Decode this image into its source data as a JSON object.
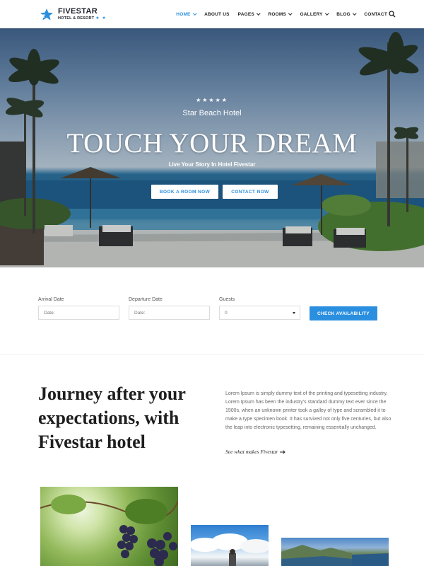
{
  "brand": {
    "name": "FIVESTAR",
    "sub": "HOTEL & RESORT",
    "stars": "★ ★",
    "accent_color": "#2b8fe0"
  },
  "nav": {
    "items": [
      {
        "label": "HOME",
        "dropdown": true,
        "active": true
      },
      {
        "label": "ABOUT US",
        "dropdown": false,
        "active": false
      },
      {
        "label": "PAGES",
        "dropdown": true,
        "active": false
      },
      {
        "label": "ROOMS",
        "dropdown": true,
        "active": false
      },
      {
        "label": "GALLERY",
        "dropdown": true,
        "active": false
      },
      {
        "label": "BLOG",
        "dropdown": true,
        "active": false
      },
      {
        "label": "CONTACT",
        "dropdown": false,
        "active": false
      }
    ],
    "search_icon": "search-icon"
  },
  "hero": {
    "stars": "★★★★★",
    "subtitle": "Star Beach Hotel",
    "title": "TOUCH YOUR DREAM",
    "tagline": "Live Your Story In Hotel Fivestar",
    "button_book": "BOOK A ROOM NOW",
    "button_contact": "CONTACT NOW"
  },
  "booking": {
    "arrival_label": "Arrival Date",
    "arrival_placeholder": "Date:",
    "departure_label": "Departure Date",
    "departure_placeholder": "Date:",
    "guests_label": "Guests",
    "guests_value": "0",
    "check_button": "CHECK AVAILABILITY"
  },
  "intro": {
    "title_line1": "Journey after your",
    "title_line2": "expectations, with",
    "title_line3": "Fivestar hotel",
    "text": "Lorem Ipsum is simply dummy text of the printing and typesetting industry. Lorem Ipsum has been the industry's standard dummy text ever since the 1500s, when an unknown printer took a galley of type and scrambled it to make a type specimen book. It has survived not only five centuries, but also the leap into electronic typesetting, remaining essentially unchanged.",
    "link": "See what makes Fivestar"
  }
}
